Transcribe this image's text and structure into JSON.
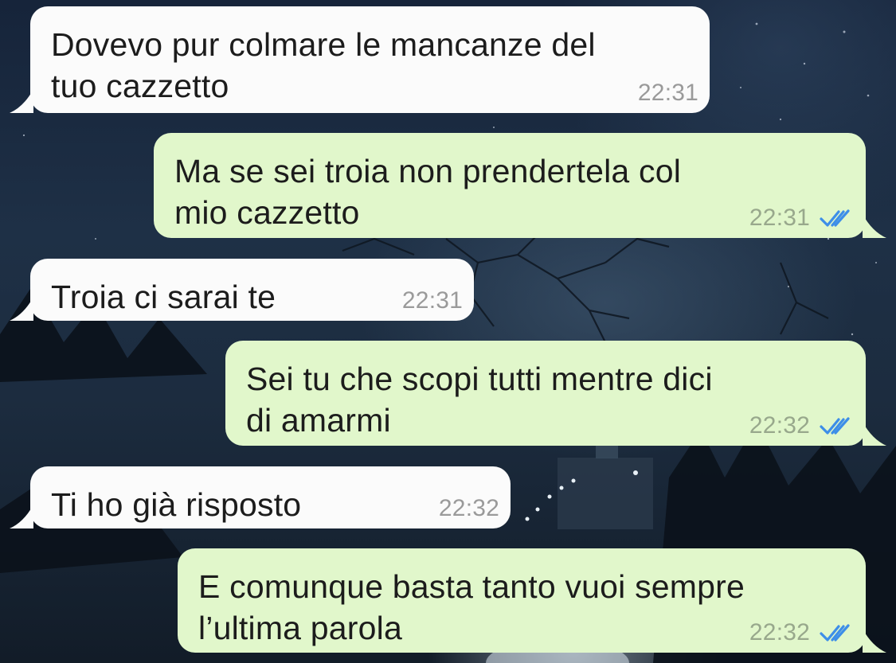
{
  "colors": {
    "incoming_bubble": "#fbfbfb",
    "outgoing_bubble": "#e1f7cb",
    "read_ticks": "#3d8ee8",
    "timestamp": "#9a9a9a"
  },
  "messages": [
    {
      "direction": "in",
      "lines": [
        "Dovevo pur colmare le mancanze del",
        "tuo cazzetto"
      ],
      "time": "22:31"
    },
    {
      "direction": "out",
      "lines": [
        "Ma se sei troia non prendertela col",
        "mio cazzetto"
      ],
      "time": "22:31",
      "status_icon": "double-check-read-icon"
    },
    {
      "direction": "in",
      "lines": [
        "Troia ci sarai te"
      ],
      "time": "22:31"
    },
    {
      "direction": "out",
      "lines": [
        "Sei tu che scopi tutti mentre dici",
        "di amarmi"
      ],
      "time": "22:32",
      "status_icon": "double-check-read-icon"
    },
    {
      "direction": "in",
      "lines": [
        "Ti ho già risposto"
      ],
      "time": "22:32"
    },
    {
      "direction": "out",
      "lines": [
        "E comunque basta tanto vuoi sempre",
        "l’ultima parola"
      ],
      "time": "22:32",
      "status_icon": "double-check-read-icon"
    }
  ]
}
